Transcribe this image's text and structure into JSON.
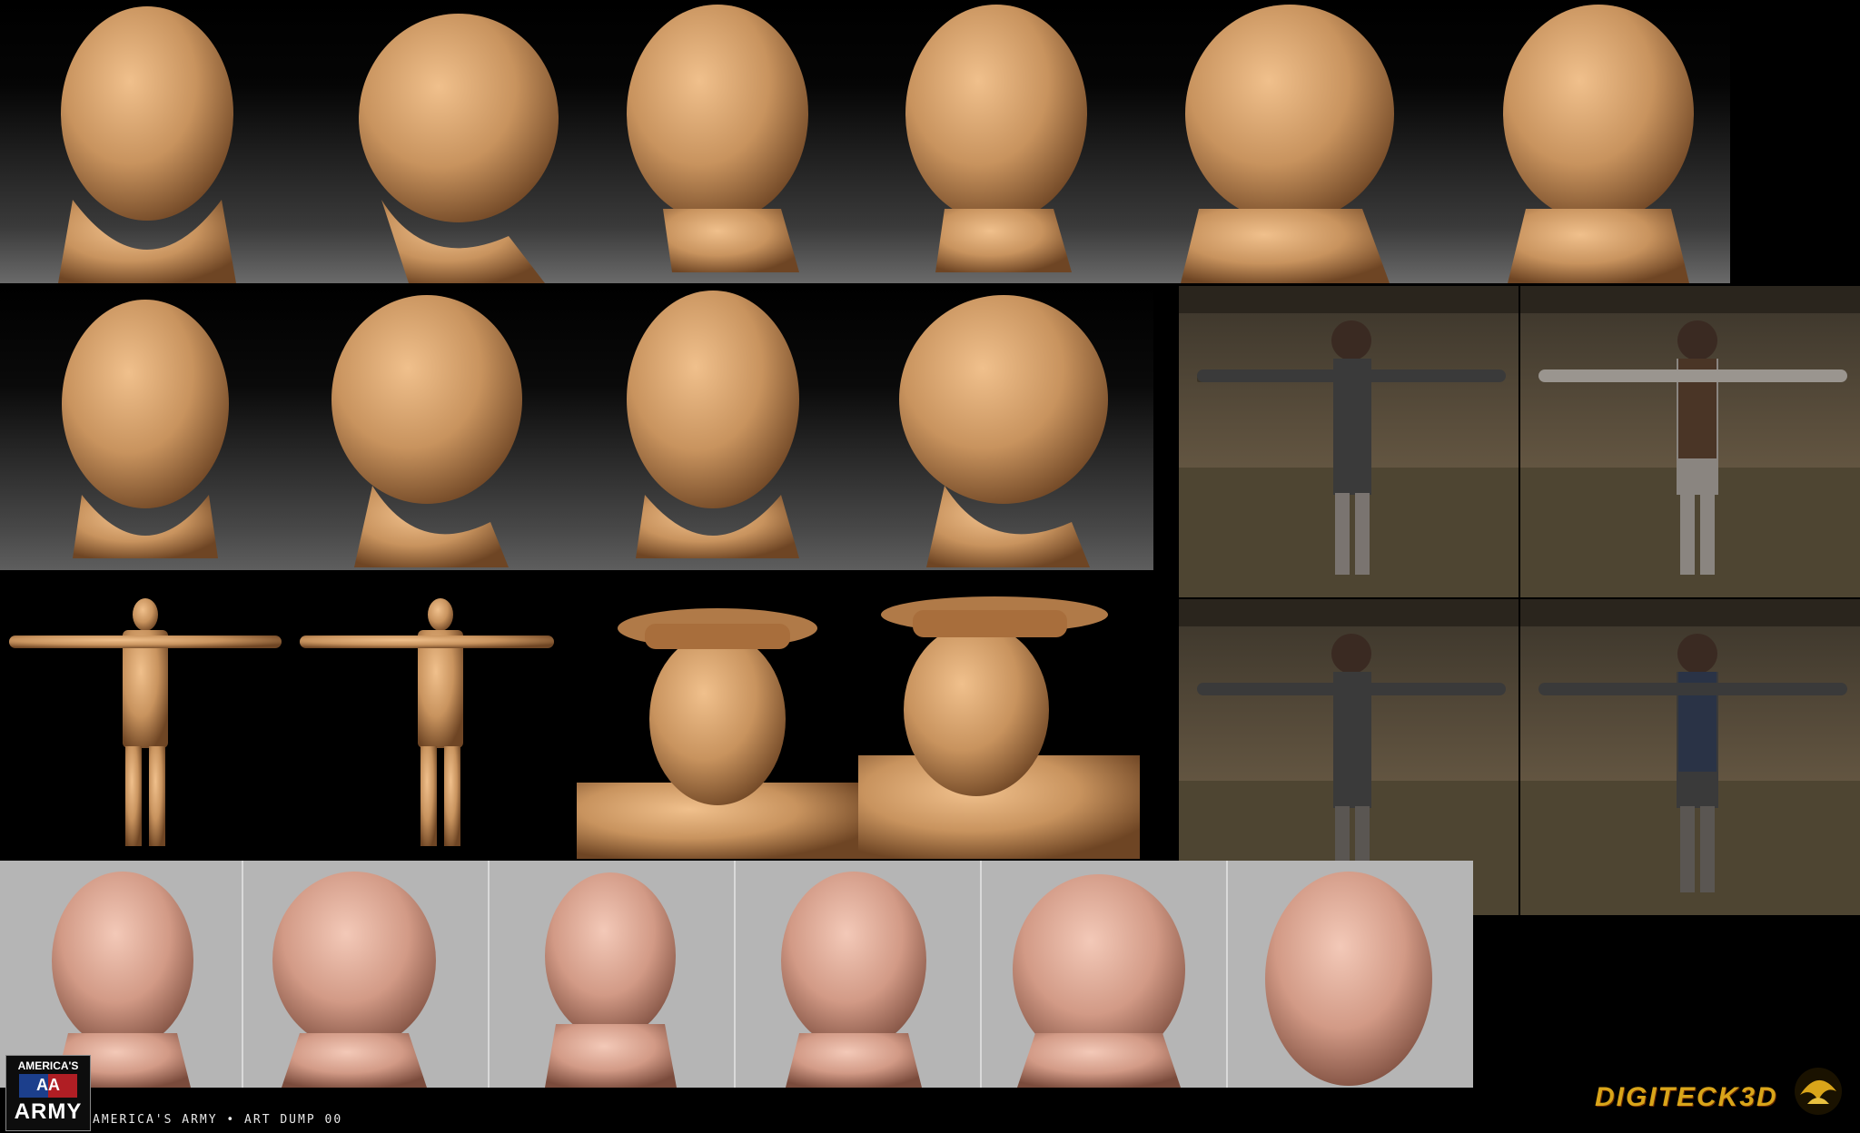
{
  "footer": {
    "caption": "AMERICA'S ARMY • ART DUMP 00"
  },
  "logos": {
    "left_top": "AMERICA'S",
    "left_mid": "AA",
    "left_bottom": "ARMY",
    "right": "DIGITECK3D"
  },
  "colors": {
    "clay": "#c8935e",
    "clay_dark": "#7a4f2a",
    "skin": "#d9a28e",
    "background": "#000000",
    "render_wall": "#5a4e3c",
    "grey_viewport": "#b5b5b5",
    "brand_gold": "#d9a51a"
  }
}
